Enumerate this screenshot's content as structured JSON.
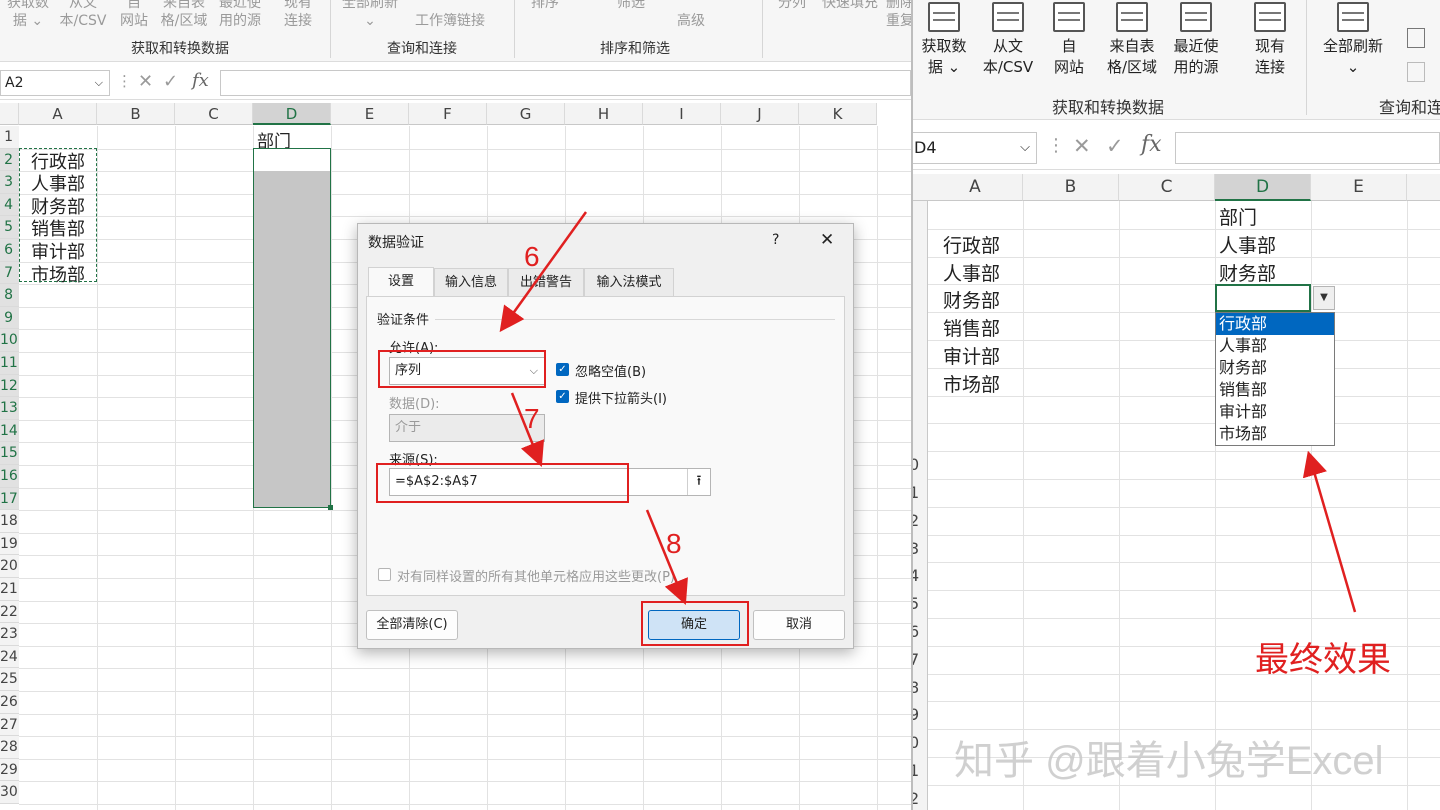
{
  "left": {
    "ribbon": {
      "buttons": [
        "获取数\n据 ⌄",
        "从文\n本/CSV",
        "自\n网站",
        "来自表\n格/区域",
        "最近使\n用的源",
        "现有\n连接",
        "全部刷新\n⌄",
        "工作簿链接",
        "排序",
        "筛选",
        "高级",
        "分列",
        "快速填充",
        "删除\n重复"
      ],
      "groups": [
        "获取和转换数据",
        "查询和连接",
        "排序和筛选"
      ]
    },
    "formula_bar": {
      "name_box": "A2",
      "fx": "fx",
      "cancel": "✕",
      "confirm": "✓"
    },
    "columns": [
      "A",
      "B",
      "C",
      "D",
      "E",
      "F",
      "G",
      "H",
      "I",
      "J",
      "K"
    ],
    "rows": [
      "1",
      "2",
      "3",
      "4",
      "5",
      "6",
      "7",
      "8",
      "9",
      "10",
      "11",
      "12",
      "13",
      "14",
      "15",
      "16",
      "17",
      "18",
      "19",
      "20",
      "21",
      "22",
      "23",
      "24",
      "25",
      "26",
      "27",
      "28",
      "29",
      "30"
    ],
    "col_a_values": [
      "行政部",
      "人事部",
      "财务部",
      "销售部",
      "审计部",
      "市场部"
    ],
    "d1_value": "部门"
  },
  "dialog": {
    "title": "数据验证",
    "help": "?",
    "close": "✕",
    "tabs": [
      "设置",
      "输入信息",
      "出错警告",
      "输入法模式"
    ],
    "section": "验证条件",
    "allow_label": "允许(A):",
    "allow_value": "序列",
    "ignore_blank": "忽略空值(B)",
    "dropdown_arrow": "提供下拉箭头(I)",
    "data_label": "数据(D):",
    "data_value": "介于",
    "source_label": "来源(S):",
    "source_value": "=$A$2:$A$7",
    "apply_all": "对有同样设置的所有其他单元格应用这些更改(P)",
    "clear_all": "全部清除(C)",
    "ok": "确定",
    "cancel": "取消"
  },
  "steps": [
    "6",
    "7",
    "8"
  ],
  "right": {
    "ribbon": {
      "buttons": [
        "获取数\n据 ⌄",
        "从文\n本/CSV",
        "自\n网站",
        "来自表\n格/区域",
        "最近使\n用的源",
        "现有\n连接",
        "全部刷新\n⌄"
      ],
      "groups": [
        "获取和转换数据",
        "查询和连"
      ]
    },
    "formula_bar": {
      "name_box": "D4",
      "fx": "fx",
      "cancel": "✕",
      "confirm": "✓"
    },
    "columns": [
      "A",
      "B",
      "C",
      "D",
      "E"
    ],
    "col_a_values": [
      "行政部",
      "人事部",
      "财务部",
      "销售部",
      "审计部",
      "市场部"
    ],
    "col_d_values": [
      "部门",
      "人事部",
      "财务部"
    ],
    "row_numbers": [
      "0",
      "1",
      "2",
      "3",
      "4",
      "5",
      "6",
      "7",
      "8",
      "9",
      "0",
      "1",
      "2"
    ],
    "dropdown_items": [
      "行政部",
      "人事部",
      "财务部",
      "销售部",
      "审计部",
      "市场部"
    ],
    "final_label": "最终效果"
  },
  "watermark": "知乎 @跟着小兔学Excel",
  "colors": {
    "accent": "#217346",
    "annotation": "#e02020",
    "highlight": "#0067c0"
  }
}
